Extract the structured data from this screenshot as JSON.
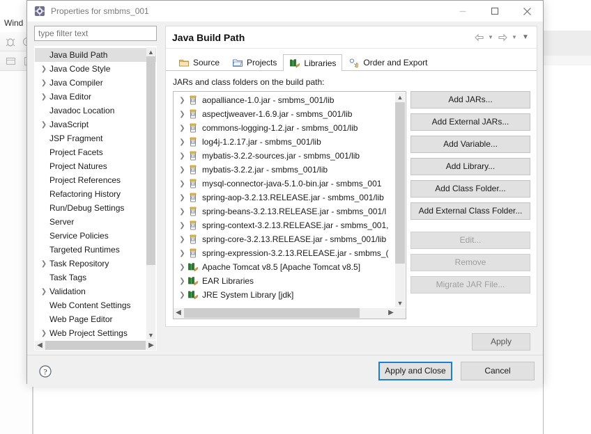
{
  "ide": {
    "menu_label": "Wind",
    "toolbar_icons": [
      "debug-icon",
      "run-icon",
      "new-icon",
      "perspective-icon"
    ]
  },
  "dialog": {
    "title": "Properties for smbms_001",
    "title_icon": "properties-gear-icon",
    "window_controls": [
      {
        "name": "minimize-button",
        "glyph": "minimize"
      },
      {
        "name": "maximize-button",
        "glyph": "maximize"
      },
      {
        "name": "close-button",
        "glyph": "close"
      }
    ]
  },
  "filter": {
    "placeholder": "type filter text",
    "value": ""
  },
  "tree": {
    "items": [
      {
        "label": "Java Build Path",
        "expandable": false,
        "selected": true
      },
      {
        "label": "Java Code Style",
        "expandable": true,
        "selected": false
      },
      {
        "label": "Java Compiler",
        "expandable": true,
        "selected": false
      },
      {
        "label": "Java Editor",
        "expandable": true,
        "selected": false
      },
      {
        "label": "Javadoc Location",
        "expandable": false,
        "selected": false
      },
      {
        "label": "JavaScript",
        "expandable": true,
        "selected": false
      },
      {
        "label": "JSP Fragment",
        "expandable": false,
        "selected": false
      },
      {
        "label": "Project Facets",
        "expandable": false,
        "selected": false
      },
      {
        "label": "Project Natures",
        "expandable": false,
        "selected": false
      },
      {
        "label": "Project References",
        "expandable": false,
        "selected": false
      },
      {
        "label": "Refactoring History",
        "expandable": false,
        "selected": false
      },
      {
        "label": "Run/Debug Settings",
        "expandable": false,
        "selected": false
      },
      {
        "label": "Server",
        "expandable": false,
        "selected": false
      },
      {
        "label": "Service Policies",
        "expandable": false,
        "selected": false
      },
      {
        "label": "Targeted Runtimes",
        "expandable": false,
        "selected": false
      },
      {
        "label": "Task Repository",
        "expandable": true,
        "selected": false
      },
      {
        "label": "Task Tags",
        "expandable": false,
        "selected": false
      },
      {
        "label": "Validation",
        "expandable": true,
        "selected": false
      },
      {
        "label": "Web Content Settings",
        "expandable": false,
        "selected": false
      },
      {
        "label": "Web Page Editor",
        "expandable": false,
        "selected": false
      },
      {
        "label": "Web Project Settings",
        "expandable": true,
        "selected": false
      }
    ]
  },
  "page": {
    "title": "Java Build Path",
    "nav": [
      {
        "name": "nav-back-icon"
      },
      {
        "name": "nav-back-dropdown-icon"
      },
      {
        "name": "nav-forward-icon"
      },
      {
        "name": "nav-forward-dropdown-icon"
      },
      {
        "name": "nav-menu-icon"
      }
    ]
  },
  "tabs": [
    {
      "label": "Source",
      "icon": "source-folder-icon",
      "active": false
    },
    {
      "label": "Projects",
      "icon": "projects-folder-icon",
      "active": false
    },
    {
      "label": "Libraries",
      "icon": "libraries-books-icon",
      "active": true
    },
    {
      "label": "Order and Export",
      "icon": "order-export-icon",
      "active": false
    }
  ],
  "list": {
    "caption": "JARs and class folders on the build path:",
    "entries": [
      {
        "label": "aopalliance-1.0.jar - smbms_001/lib",
        "icon": "jar-icon"
      },
      {
        "label": "aspectjweaver-1.6.9.jar - smbms_001/lib",
        "icon": "jar-icon"
      },
      {
        "label": "commons-logging-1.2.jar - smbms_001/lib",
        "icon": "jar-icon"
      },
      {
        "label": "log4j-1.2.17.jar - smbms_001/lib",
        "icon": "jar-icon"
      },
      {
        "label": "mybatis-3.2.2-sources.jar - smbms_001/lib",
        "icon": "jar-icon"
      },
      {
        "label": "mybatis-3.2.2.jar - smbms_001/lib",
        "icon": "jar-icon"
      },
      {
        "label": "mysql-connector-java-5.1.0-bin.jar - smbms_001",
        "icon": "jar-icon"
      },
      {
        "label": "spring-aop-3.2.13.RELEASE.jar - smbms_001/lib",
        "icon": "jar-icon"
      },
      {
        "label": "spring-beans-3.2.13.RELEASE.jar - smbms_001/l",
        "icon": "jar-icon"
      },
      {
        "label": "spring-context-3.2.13.RELEASE.jar - smbms_001,",
        "icon": "jar-icon"
      },
      {
        "label": "spring-core-3.2.13.RELEASE.jar - smbms_001/lib",
        "icon": "jar-icon"
      },
      {
        "label": "spring-expression-3.2.13.RELEASE.jar - smbms_(",
        "icon": "jar-icon"
      },
      {
        "label": "Apache Tomcat v8.5 [Apache Tomcat v8.5]",
        "icon": "library-icon"
      },
      {
        "label": "EAR Libraries",
        "icon": "library-icon"
      },
      {
        "label": "JRE System Library [jdk]",
        "icon": "library-icon"
      }
    ]
  },
  "side_buttons": [
    {
      "label": "Add JARs...",
      "enabled": true
    },
    {
      "label": "Add External JARs...",
      "enabled": true
    },
    {
      "label": "Add Variable...",
      "enabled": true
    },
    {
      "label": "Add Library...",
      "enabled": true
    },
    {
      "label": "Add Class Folder...",
      "enabled": true
    },
    {
      "label": "Add External Class Folder...",
      "enabled": true
    },
    {
      "label": "Edit...",
      "enabled": false
    },
    {
      "label": "Remove",
      "enabled": false
    },
    {
      "label": "Migrate JAR File...",
      "enabled": false
    }
  ],
  "apply": {
    "label": "Apply"
  },
  "footer": {
    "help_icon": "help-question-icon",
    "apply_and_close": "Apply and Close",
    "cancel": "Cancel"
  },
  "colors": {
    "focus_border": "#1a7fd4",
    "dialog_bg": "#f0f0f0",
    "selection_bg": "#dfdfdf",
    "button_bg": "#e1e1e1"
  }
}
